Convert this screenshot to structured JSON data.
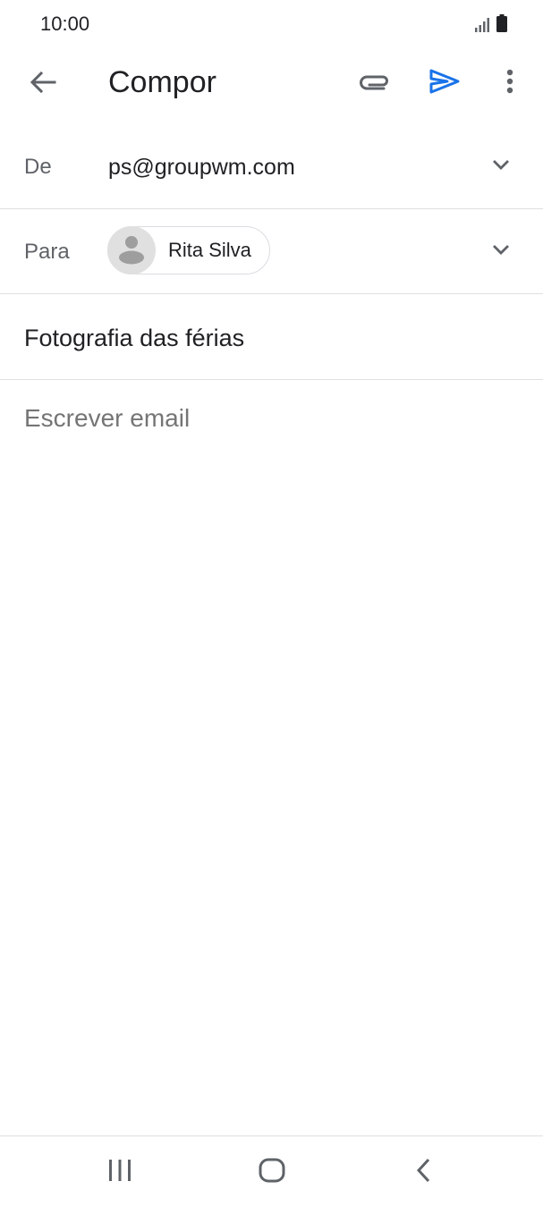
{
  "status": {
    "time": "10:00",
    "icons": [
      "signal-icon",
      "battery-icon"
    ]
  },
  "toolbar": {
    "title": "Compor",
    "icons": [
      "back-arrow-icon",
      "attach-icon",
      "send-icon",
      "more-vert-icon"
    ],
    "send_color": "#1a73e8"
  },
  "compose": {
    "from_label": "De",
    "from_value": "ps@groupwm.com",
    "to_label": "Para",
    "to_recipient": "Rita Silva",
    "subject": "Fotografia das férias",
    "body_placeholder": "Escrever email"
  },
  "nav": {
    "icons": [
      "recents-icon",
      "home-icon",
      "nav-back-icon"
    ]
  }
}
